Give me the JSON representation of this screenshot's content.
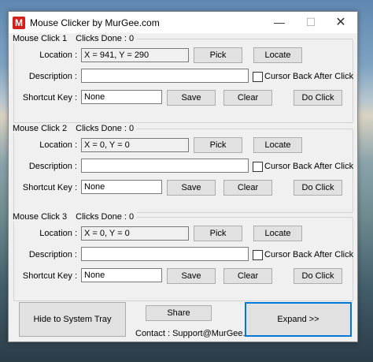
{
  "window": {
    "title": "Mouse Clicker by MurGee.com",
    "icon_letter": "M",
    "controls": {
      "minimize": "—",
      "maximize": "☐",
      "close": "✕"
    }
  },
  "labels": {
    "location": "Location :",
    "description": "Description :",
    "shortcut": "Shortcut Key :",
    "pick": "Pick",
    "locate": "Locate",
    "cursor_back": "Cursor Back After Click",
    "save": "Save",
    "clear": "Clear",
    "do_click": "Do Click"
  },
  "clicks": [
    {
      "title": "Mouse Click 1",
      "clicks_done": "Clicks Done : 0",
      "location": "X = 941, Y = 290",
      "description": "",
      "shortcut": "None",
      "cursor_back": false
    },
    {
      "title": "Mouse Click 2",
      "clicks_done": "Clicks Done : 0",
      "location": "X = 0, Y = 0",
      "description": "",
      "shortcut": "None",
      "cursor_back": false
    },
    {
      "title": "Mouse Click 3",
      "clicks_done": "Clicks Done : 0",
      "location": "X = 0, Y = 0",
      "description": "",
      "shortcut": "None",
      "cursor_back": false
    }
  ],
  "footer": {
    "hide_tray": "Hide to System Tray",
    "share": "Share",
    "contact": "Contact : Support@MurGee.com",
    "expand": "Expand >>"
  }
}
